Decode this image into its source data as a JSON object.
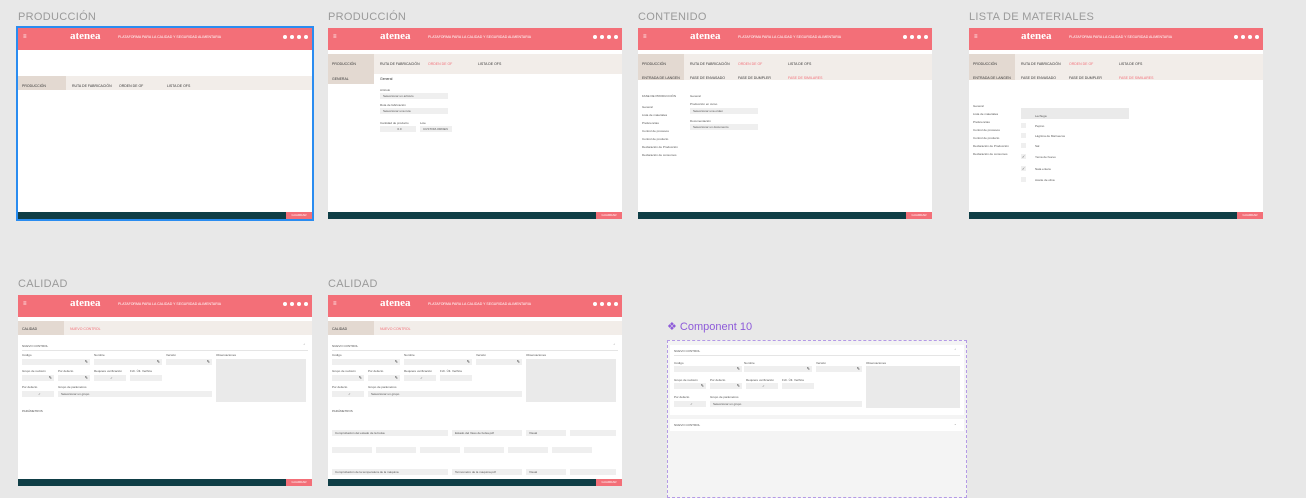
{
  "frames": [
    {
      "title": "PRODUCCIÓN"
    },
    {
      "title": "PRODUCCIÓN"
    },
    {
      "title": "CONTENIDO"
    },
    {
      "title": "LISTA DE MATERIALES"
    },
    {
      "title": "CALIDAD"
    },
    {
      "title": "CALIDAD"
    }
  ],
  "header": {
    "menu_icon": "hamburger-icon",
    "brand": "atenea",
    "tagline": "PLATAFORMA PARA LA CALIDAD Y SEGURIDAD ALIMENTARIA",
    "icons": [
      "help-icon",
      "settings-icon",
      "notification-icon",
      "user-icon"
    ]
  },
  "footer": {
    "button": "GUARDAR"
  },
  "produccion": {
    "section": "PRODUCCIÓN",
    "tabs": [
      "RUTA DE FABRICACIÓN",
      "ORDEN DE OF",
      "LISTA DE OFS"
    ],
    "sub": "GENERAL",
    "subhead": "General",
    "fields": [
      {
        "label": "Artículo",
        "value": "Seleccionar un artículo"
      },
      {
        "label": "Ruta de fabricación",
        "value": "Seleccionar una ruta"
      },
      {
        "label": "Cantidad de producto",
        "value": "0.0"
      },
      {
        "label": "Lote",
        "value": "CUSTOM-ORDEN"
      }
    ]
  },
  "contenido": {
    "section": "PRODUCCIÓN",
    "tabs": [
      "RUTA DE FABRICACIÓN",
      "ORDEN DE OF",
      "LISTA DE OFS"
    ],
    "subtabs": [
      "ENTRADA DE LANGEN",
      "FASE DE ENVASADO",
      "FASE DE DUMPLER",
      "FASE DE SIMILARES"
    ],
    "side_label": "FASE DE PRODUCCIÓN",
    "side_value": "General",
    "menu": [
      "General",
      "Lista de materiales",
      "Preferencias",
      "Control de procesos",
      "Control de producto",
      "Declaración de Producción",
      "Declaración de consumos"
    ],
    "field_labels": [
      "Producción en curso",
      "Documentación"
    ],
    "field_values": [
      "Seleccionar una orden",
      "Seleccionar un documento"
    ]
  },
  "lista": {
    "section": "PRODUCCIÓN",
    "tabs": [
      "RUTA DE FABRICACIÓN",
      "ORDEN DE OF",
      "LISTA DE OFS"
    ],
    "subtabs": [
      "ENTRADA DE LANGEN",
      "FASE DE ENVASADO",
      "FASE DE DUMPLER",
      "FASE DE SIMILARES"
    ],
    "menu": [
      "General",
      "Lista de materiales",
      "Preferencias",
      "Control de procesos",
      "Control de producto",
      "Declaración de Producción",
      "Declaración de consumos"
    ],
    "materials": [
      "Lechuga",
      "Pepino",
      "Lágrima de Marruecos",
      "Sal",
      "Yema de huevo",
      "Nata entera",
      "Aceite de oliva",
      "Harina de trigo",
      "Sirope de 1000"
    ]
  },
  "calidad": {
    "tabs": [
      "CALIDAD",
      "NUEVO CONTROL"
    ],
    "section_head": "NUEVO CONTROL",
    "labels": [
      "Código",
      "Nombre",
      "Versión",
      "Observaciones",
      "Grupo de revisión",
      "Por defecto",
      "Requiere verificación",
      "Fch. Últ. Verifica",
      "Por defecto",
      "Grupo de parámetros"
    ],
    "group_value": "Seleccionar un grupo",
    "parametros": "PARÁMETROS",
    "param_rows": [
      {
        "desc": "Comprobación del estado de la bolsa",
        "doc": "Estado del Vaso de bolsa.pdf",
        "tipo": "Visual"
      },
      {
        "desc": "Comprobación de la temperatura de la máquina",
        "doc": "Termometro de la maquina.pdf",
        "tipo": "Visual"
      }
    ]
  },
  "component": {
    "title": "❖ Component 10",
    "rows": [
      {
        "label": "NUEVO CONTROL"
      },
      {
        "label": "NUEVO CONTROL"
      }
    ],
    "group_value": "Seleccionar un grupo"
  }
}
